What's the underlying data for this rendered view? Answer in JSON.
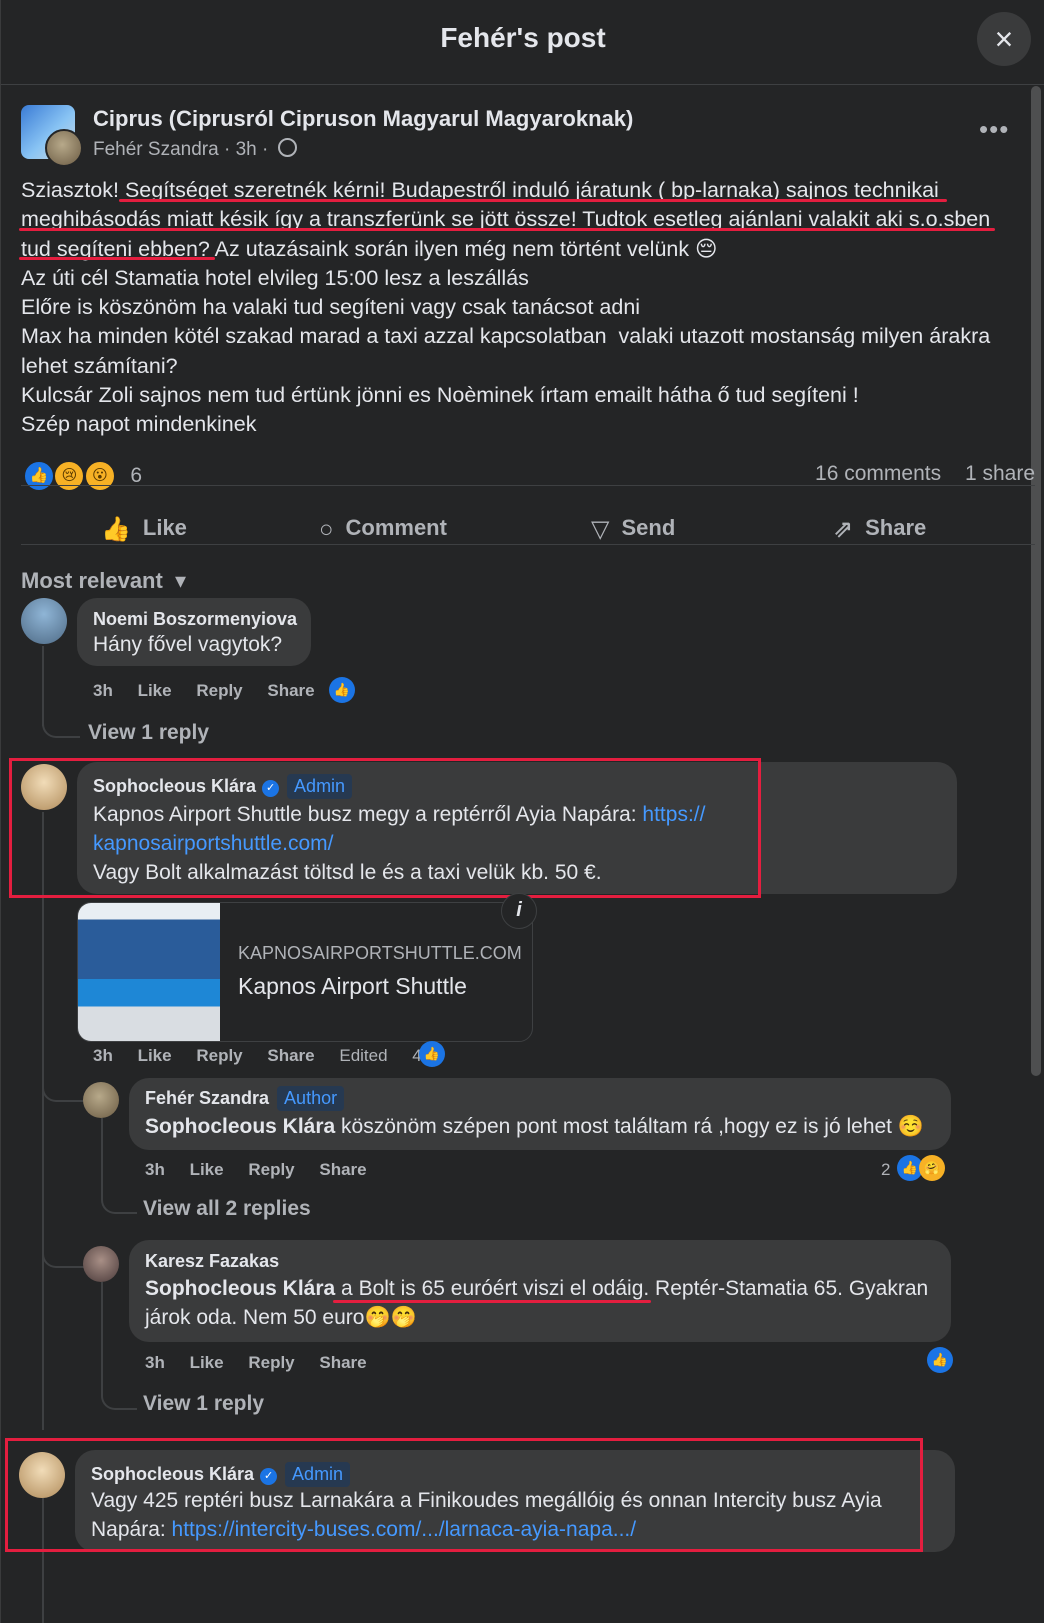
{
  "header": {
    "title": "Fehér's post",
    "close_icon": "×"
  },
  "post": {
    "group_name": "Ciprus (Ciprusról Cipruson Magyarul Magyaroknak)",
    "author": "Fehér Szandra",
    "time": "3h",
    "dot": "·",
    "more": "•••",
    "lines": [
      "Sziasztok! Segítséget szeretnék kérni! Budapestről induló járatunk ( bp-larnaka) sajnos technikai",
      "meghibásodás miatt késik így a transzferünk se jött össze! Tudtok esetleg ajánlani valakit aki s.o.sben",
      "tud segíteni ebben? Az utazásaink során ilyen még nem történt velünk 😔",
      "Az úti cél Stamatia hotel elvileg 15:00 lesz a leszállás",
      "Előre is köszönöm ha valaki tud segíteni vagy csak tanácsot adni",
      "Max ha minden kötél szakad marad a taxi azzal kapcsolatban  valaki utazott mostanság milyen árakra",
      "lehet számítani?",
      "Kulcsár Zoli sajnos nem tud értünk jönni es Noèminek írtam emailt hátha ő tud segíteni !",
      "Szép napot mindenkinek"
    ],
    "reaction_count": "6",
    "reaction_icons": [
      "👍",
      "😢",
      "😮"
    ],
    "comments_count": "16 comments",
    "shares_count": "1 share"
  },
  "actions": {
    "like": "Like",
    "like_icon": "👍",
    "comment": "Comment",
    "comment_icon": "○",
    "send": "Send",
    "send_icon": "▽",
    "share": "Share",
    "share_icon": "⇗"
  },
  "sort": {
    "label": "Most relevant",
    "chevron": "▾"
  },
  "comments": [
    {
      "name": "Noemi Boszormenyiova",
      "text": "Hány fővel vagytok?",
      "time": "3h",
      "like": "Like",
      "reply": "Reply",
      "share": "Share",
      "view_replies": "View 1 reply"
    },
    {
      "name": "Sophocleous Klára",
      "badge": "Admin",
      "text1": "Kapnos Airport Shuttle busz megy a reptérről Ayia Napára: ",
      "link1": "https://",
      "link2": "kapnosairportshuttle.com/",
      "text2": "Vagy Bolt alkalmazást töltsd le és a taxi velük kb. 50 €.",
      "card_domain": "KAPNOSAIRPORTSHUTTLE.COM",
      "card_title": "Kapnos Airport Shuttle",
      "card_info": "i",
      "time": "3h",
      "like": "Like",
      "reply": "Reply",
      "share": "Share",
      "edited": "Edited",
      "reaction_count": "4"
    },
    {
      "name": "Fehér Szandra",
      "badge": "Author",
      "mention": "Sophocleous Klára",
      "text": " köszönöm szépen pont most találtam rá ,hogy ez is jó lehet ☺️",
      "time": "3h",
      "like": "Like",
      "reply": "Reply",
      "share": "Share",
      "reaction_count": "2",
      "view_replies": "View all 2 replies"
    },
    {
      "name": "Karesz Fazakas",
      "mention": "Sophocleous Klára",
      "text_a": " a Bolt is 65 euróért viszi el odáig",
      "text_b": ". Reptér-Stamatia 65. Gyakran",
      "text_c": "járok oda. Nem 50 euro🤭🤭",
      "time": "3h",
      "like": "Like",
      "reply": "Reply",
      "share": "Share",
      "view_replies": "View 1 reply"
    },
    {
      "name": "Sophocleous Klára",
      "badge": "Admin",
      "text1": "Vagy 425 reptéri busz Larnakára a Finikoudes megállóig és onnan Intercity busz Ayia",
      "text2": "Napára: ",
      "link": "https://intercity-buses.com/.../larnaca-ayia-napa.../"
    }
  ],
  "colors": {
    "accent": "#1b74e4",
    "highlight": "#e41e3f",
    "link": "#4599ff"
  }
}
